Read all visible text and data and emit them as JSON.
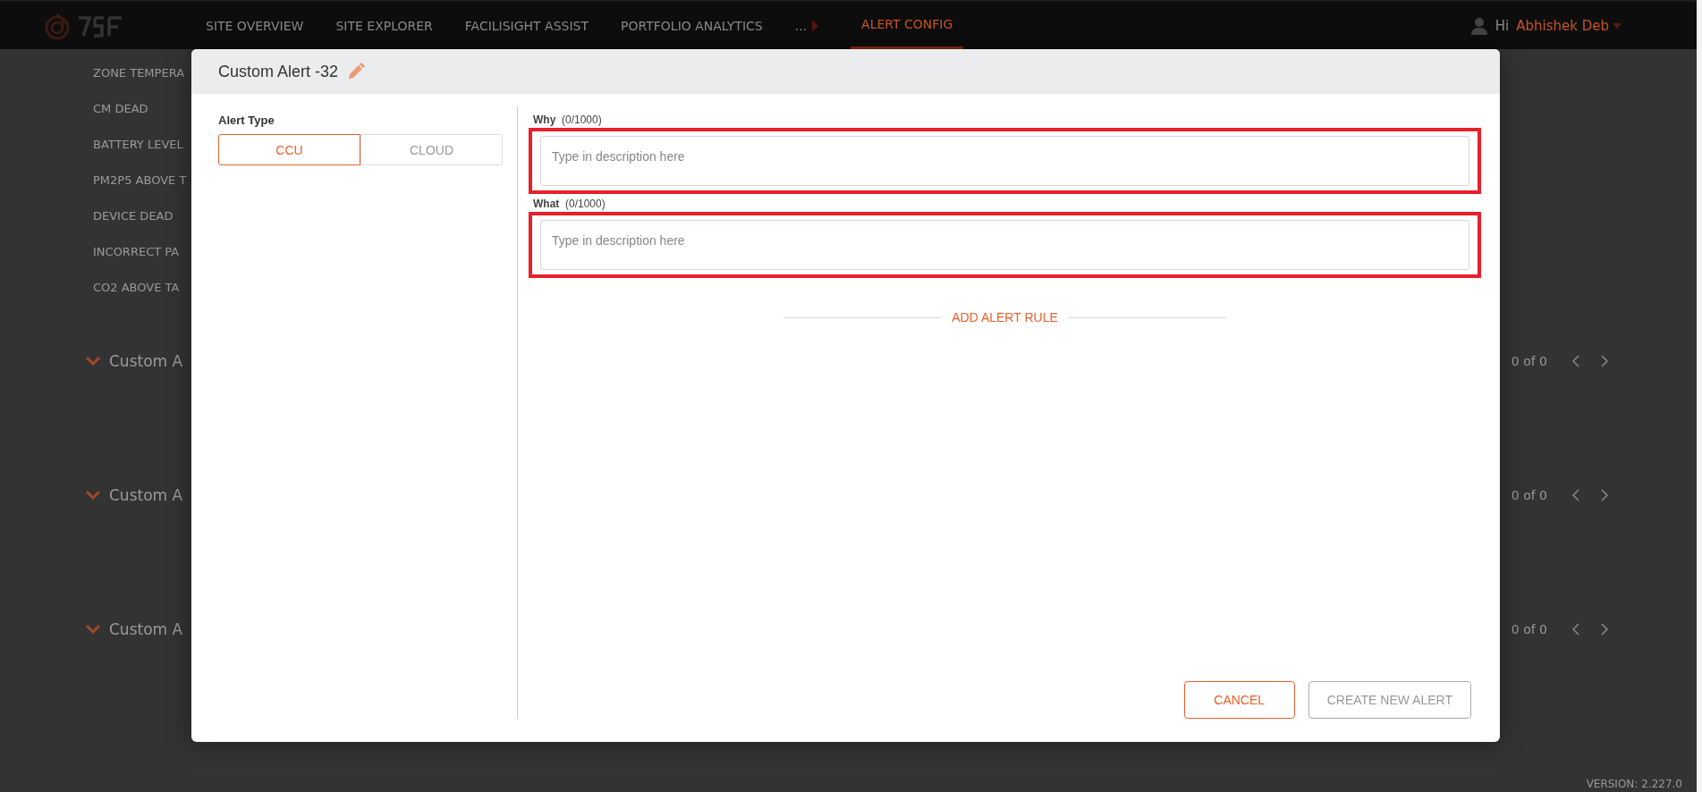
{
  "nav": {
    "items": [
      {
        "label": "SITE OVERVIEW",
        "kind": "link",
        "selected": false
      },
      {
        "label": "SITE EXPLORER",
        "kind": "link",
        "selected": false
      },
      {
        "label": "FACILISIGHT ASSIST",
        "kind": "link",
        "selected": false
      },
      {
        "label": "PORTFOLIO ANALYTICS",
        "kind": "link",
        "selected": false
      },
      {
        "label": "...",
        "kind": "more",
        "selected": false
      },
      {
        "label": "ALERT CONFIG",
        "kind": "link",
        "selected": true
      }
    ],
    "user": {
      "greeting": "Hi",
      "name": "Abhishek Deb"
    }
  },
  "background": {
    "alert_list": [
      "ZONE TEMPERA",
      "CM DEAD",
      "BATTERY LEVEL",
      "PM2P5 ABOVE T",
      "DEVICE DEAD",
      "INCORRECT PA",
      "CO2 ABOVE TA"
    ],
    "sections": [
      {
        "title": "Custom A",
        "count": "0 of 0"
      },
      {
        "title": "Custom A",
        "count": "0 of 0"
      },
      {
        "title": "Custom A",
        "count": "0 of 0"
      }
    ],
    "version": "VERSION: 2.227.0"
  },
  "dialog": {
    "title": "Custom Alert -32",
    "alert_type": {
      "label": "Alert Type",
      "options": [
        {
          "label": "CCU",
          "selected": true
        },
        {
          "label": "CLOUD",
          "selected": false
        }
      ]
    },
    "fields": [
      {
        "label": "Why",
        "counter": "(0/1000)",
        "placeholder": "Type in description here",
        "highlighted": true
      },
      {
        "label": "What",
        "counter": "(0/1000)",
        "placeholder": "Type in description here",
        "highlighted": true
      }
    ],
    "add_rule": "ADD ALERT RULE",
    "buttons": [
      {
        "label": "CANCEL",
        "kind": "secondary",
        "disabled": false
      },
      {
        "label": "CREATE NEW ALERT",
        "kind": "primary",
        "disabled": true
      }
    ]
  }
}
